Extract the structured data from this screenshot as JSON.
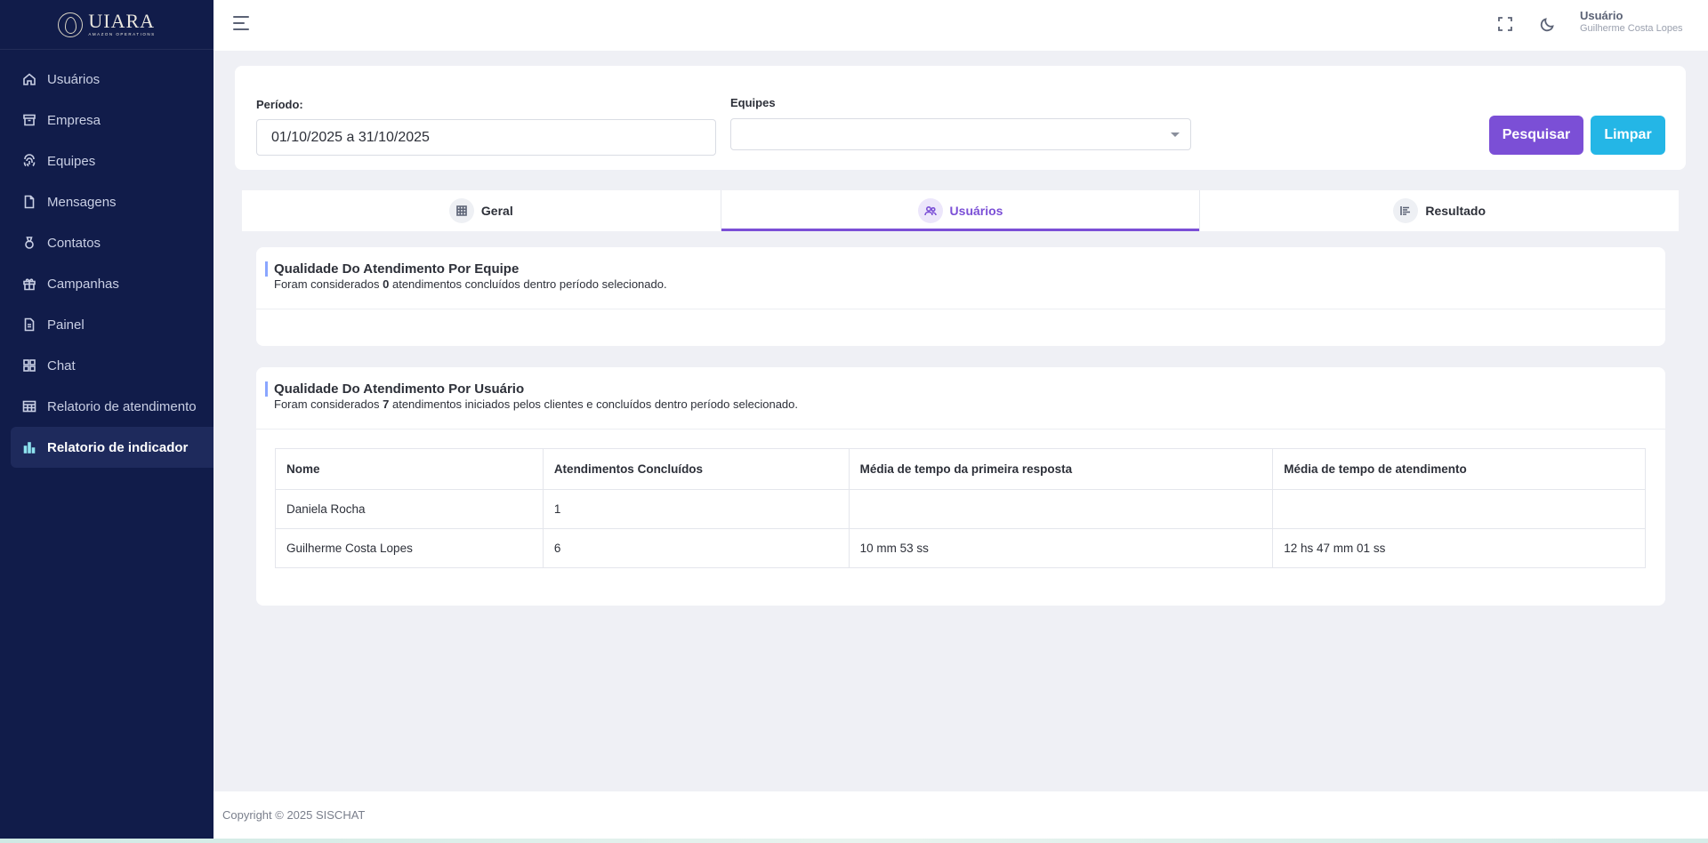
{
  "brand": {
    "logo_text": "UIARA",
    "logo_subtext": "AMAZON OPERATIONS"
  },
  "sidebar": {
    "items": [
      {
        "label": "Usuários",
        "icon": "home-icon"
      },
      {
        "label": "Empresa",
        "icon": "archive-icon"
      },
      {
        "label": "Equipes",
        "icon": "fingerprint-icon"
      },
      {
        "label": "Mensagens",
        "icon": "file-icon"
      },
      {
        "label": "Contatos",
        "icon": "medal-icon"
      },
      {
        "label": "Campanhas",
        "icon": "gift-icon"
      },
      {
        "label": "Painel",
        "icon": "document-icon"
      },
      {
        "label": "Chat",
        "icon": "grid-icon"
      },
      {
        "label": "Relatorio de atendimento",
        "icon": "table-icon"
      },
      {
        "label": "Relatorio de indicador",
        "icon": "bar-chart-icon",
        "active": true
      }
    ]
  },
  "header": {
    "user_role": "Usuário",
    "user_name": "Guilherme Costa Lopes"
  },
  "filters": {
    "period_label": "Período:",
    "period_value": "01/10/2025 a 31/10/2025",
    "teams_label": "Equipes",
    "teams_value": "",
    "search_button": "Pesquisar",
    "clear_button": "Limpar"
  },
  "tabs": [
    {
      "label": "Geral",
      "icon": "grid-pattern-icon"
    },
    {
      "label": "Usuários",
      "icon": "users-icon",
      "active": true
    },
    {
      "label": "Resultado",
      "icon": "bar-list-icon"
    }
  ],
  "team_quality": {
    "title": "Qualidade Do Atendimento Por Equipe",
    "sub_prefix": "Foram considerados",
    "count": "0",
    "sub_suffix": "atendimentos concluídos dentro período selecionado."
  },
  "user_quality": {
    "title": "Qualidade Do Atendimento Por Usuário",
    "sub_prefix": "Foram considerados",
    "count": "7",
    "sub_suffix": "atendimentos iniciados pelos clientes e concluídos dentro período selecionado.",
    "columns": [
      "Nome",
      "Atendimentos Concluídos",
      "Média de tempo da primeira resposta",
      "Média de tempo de atendimento"
    ],
    "rows": [
      [
        "Daniela Rocha",
        "1",
        "",
        ""
      ],
      [
        "Guilherme Costa Lopes",
        "6",
        "10 mm 53 ss",
        "12 hs 47 mm 01 ss"
      ]
    ]
  },
  "footer": {
    "text": "Copyright © 2025 SISCHAT"
  },
  "colors": {
    "sidebar_bg": "#111c4a",
    "accent_purple": "#7b4fd6",
    "accent_cyan": "#24b6e6",
    "page_bg": "#eff0f5"
  }
}
